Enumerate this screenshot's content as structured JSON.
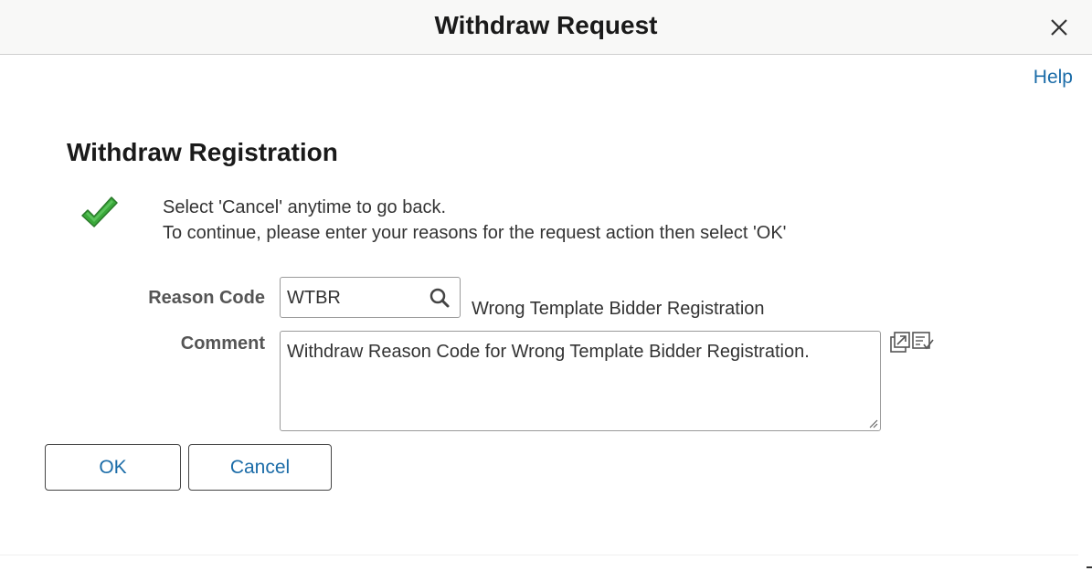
{
  "dialog": {
    "title": "Withdraw Request",
    "help_label": "Help"
  },
  "section": {
    "title": "Withdraw Registration"
  },
  "messages": {
    "line1": "Select 'Cancel' anytime to go back.",
    "line2": "To continue, please enter your reasons for the request action then select 'OK'"
  },
  "form": {
    "reason_code_label": "Reason Code",
    "reason_code_value": "WTBR",
    "reason_code_description": "Wrong Template Bidder Registration",
    "comment_label": "Comment",
    "comment_value": "Withdraw Reason Code for Wrong Template Bidder Registration."
  },
  "buttons": {
    "ok_label": "OK",
    "cancel_label": "Cancel"
  },
  "icons": {
    "close": "close-icon",
    "check": "checkmark-icon",
    "search": "search-icon",
    "expand": "expand-text-icon",
    "spellcheck": "spellcheck-icon",
    "resize": "resize-handle-icon"
  },
  "colors": {
    "link": "#1b6ca8",
    "check_green": "#3aa83a",
    "title_bar": "#f8f8f7"
  }
}
